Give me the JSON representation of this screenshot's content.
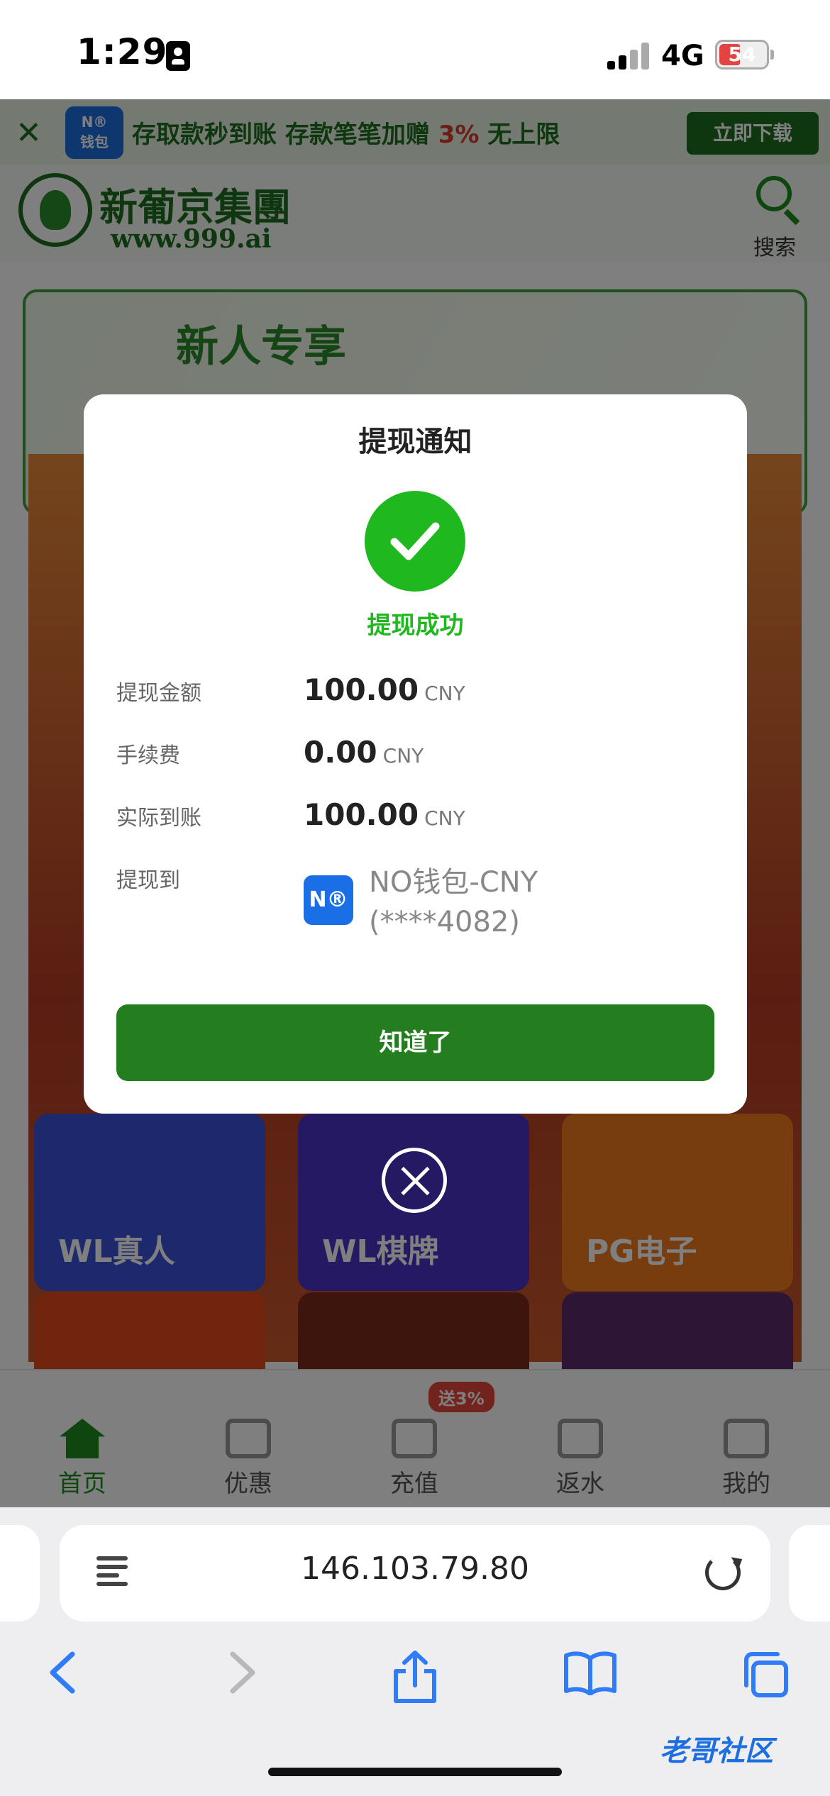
{
  "status_bar": {
    "time": "1:29",
    "network": "4G",
    "battery": "54"
  },
  "promo": {
    "wallet_logo": "N®\n钱包",
    "text_a": "存取款秒到账 存款笔笔加赠 ",
    "text_pct": "3%",
    "text_b": " 无上限",
    "download_button": "立即下载"
  },
  "header": {
    "brand_name": "新葡京集團",
    "brand_url": "www.999.ai",
    "search_label": "搜索"
  },
  "banner": {
    "title": "新人专享"
  },
  "games": [
    {
      "name": "WL真人",
      "color": "#3a52d8"
    },
    {
      "name": "WL棋牌",
      "color": "#4b32c8"
    },
    {
      "name": "PG电子",
      "color": "#f07a1e"
    }
  ],
  "tabbar": {
    "home": "首页",
    "offers": "优惠",
    "deposit": "充值",
    "deposit_badge": "送3%",
    "rebate": "返水",
    "mine": "我的"
  },
  "dialog": {
    "title": "提现通知",
    "status": "提现成功",
    "rows": [
      {
        "label": "提现金额",
        "value": "100.00",
        "currency": "CNY"
      },
      {
        "label": "手续费",
        "value": "0.00",
        "currency": "CNY"
      },
      {
        "label": "实际到账",
        "value": "100.00",
        "currency": "CNY"
      }
    ],
    "destination_label": "提现到",
    "wallet_logo": "N®",
    "wallet_name": "NO钱包-CNY",
    "wallet_account": "(****4082)",
    "confirm_button": "知道了",
    "accent_color": "#1fb91f",
    "button_color": "#247e20"
  },
  "browser": {
    "url": "146.103.79.80"
  },
  "watermark": "老哥社区",
  "icons": {
    "close": "close-icon",
    "check": "check-icon",
    "search": "search-icon",
    "back": "chevron-left-icon",
    "forward": "chevron-right-icon",
    "share": "share-icon",
    "bookmarks": "book-icon",
    "tabs": "tabs-icon",
    "reload": "reload-icon"
  }
}
